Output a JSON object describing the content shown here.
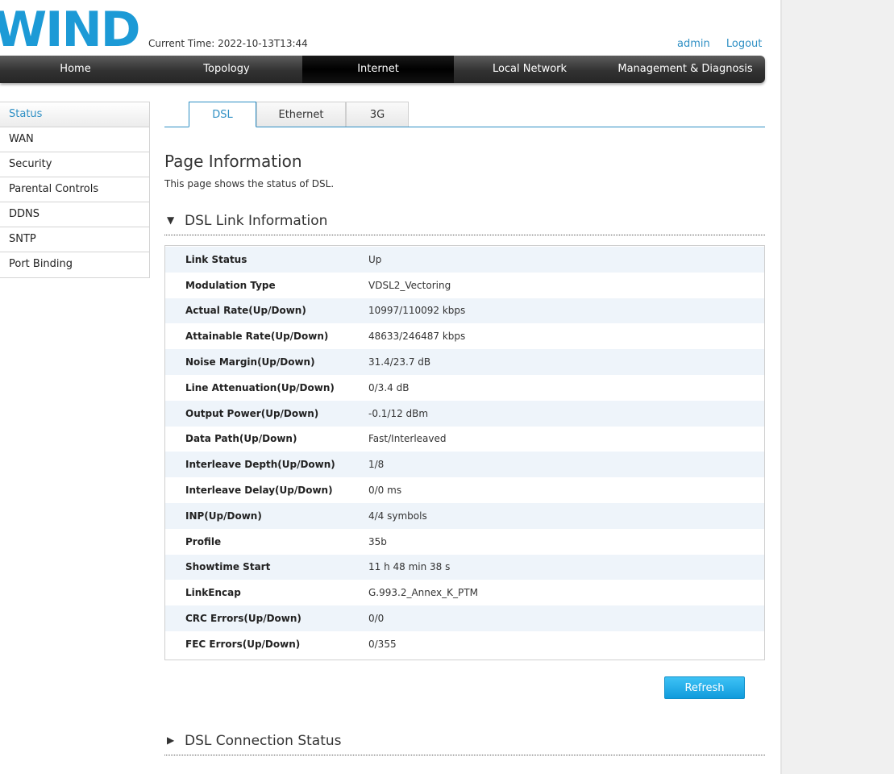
{
  "header": {
    "logo": "WIND",
    "current_time": "Current Time: 2022-10-13T13:44",
    "user": "admin",
    "logout": "Logout"
  },
  "nav": [
    {
      "label": "Home",
      "active": false
    },
    {
      "label": "Topology",
      "active": false
    },
    {
      "label": "Internet",
      "active": true
    },
    {
      "label": "Local Network",
      "active": false
    },
    {
      "label": "Management & Diagnosis",
      "active": false
    }
  ],
  "sidebar": {
    "items": [
      {
        "label": "Status",
        "active": true
      },
      {
        "label": "WAN",
        "active": false
      },
      {
        "label": "Security",
        "active": false
      },
      {
        "label": "Parental Controls",
        "active": false
      },
      {
        "label": "DDNS",
        "active": false
      },
      {
        "label": "SNTP",
        "active": false
      },
      {
        "label": "Port Binding",
        "active": false
      }
    ]
  },
  "tabs": [
    {
      "label": "DSL",
      "active": true
    },
    {
      "label": "Ethernet",
      "active": false
    },
    {
      "label": "3G",
      "active": false
    }
  ],
  "page": {
    "title": "Page Information",
    "description": "This page shows the status of DSL."
  },
  "dsl_link": {
    "title": "DSL Link Information",
    "expanded_icon": "triangle-down-icon",
    "rows": [
      {
        "label": "Link Status",
        "value": "Up"
      },
      {
        "label": "Modulation Type",
        "value": "VDSL2_Vectoring"
      },
      {
        "label": "Actual Rate(Up/Down)",
        "value": "10997/110092 kbps"
      },
      {
        "label": "Attainable Rate(Up/Down)",
        "value": "48633/246487 kbps"
      },
      {
        "label": "Noise Margin(Up/Down)",
        "value": "31.4/23.7 dB"
      },
      {
        "label": "Line Attenuation(Up/Down)",
        "value": "0/3.4 dB"
      },
      {
        "label": "Output Power(Up/Down)",
        "value": "-0.1/12 dBm"
      },
      {
        "label": "Data Path(Up/Down)",
        "value": "Fast/Interleaved"
      },
      {
        "label": "Interleave Depth(Up/Down)",
        "value": "1/8"
      },
      {
        "label": "Interleave Delay(Up/Down)",
        "value": "0/0 ms"
      },
      {
        "label": "INP(Up/Down)",
        "value": "4/4 symbols"
      },
      {
        "label": "Profile",
        "value": "35b"
      },
      {
        "label": "Showtime Start",
        "value": "11 h 48 min 38 s"
      },
      {
        "label": "LinkEncap",
        "value": "G.993.2_Annex_K_PTM"
      },
      {
        "label": "CRC Errors(Up/Down)",
        "value": "0/0"
      },
      {
        "label": "FEC Errors(Up/Down)",
        "value": "0/355"
      }
    ]
  },
  "refresh_label": "Refresh",
  "dsl_connection": {
    "title": "DSL Connection Status",
    "collapsed_icon": "triangle-right-icon"
  },
  "colors": {
    "brand": "#1c9ad6",
    "accent": "#2e8fc4",
    "button": "#1aa6e6",
    "row_alt": "#eef4fa"
  }
}
